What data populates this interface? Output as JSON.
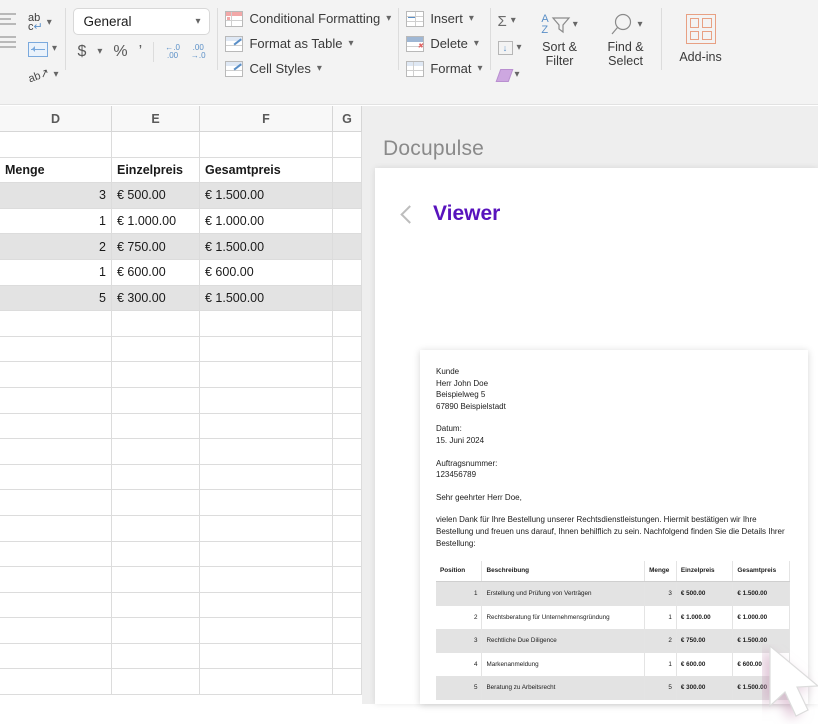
{
  "ribbon": {
    "alignment": {
      "wrap_text_label": "ab",
      "wrap_text_sub": "c",
      "merge_label": "merge-cells",
      "orientation_label": "ab"
    },
    "number": {
      "format_value": "General",
      "currency_label": "$",
      "percent_label": "%",
      "comma_label": "’",
      "increase_decimal_label": ".00",
      "decrease_decimal_label": ".0"
    },
    "styles": [
      {
        "label": "Conditional Formatting",
        "icon": "conditional-formatting-icon"
      },
      {
        "label": "Format as Table",
        "icon": "format-as-table-icon"
      },
      {
        "label": "Cell Styles",
        "icon": "cell-styles-icon"
      }
    ],
    "cells": [
      {
        "label": "Insert",
        "icon": "insert-cells-icon"
      },
      {
        "label": "Delete",
        "icon": "delete-cells-icon"
      },
      {
        "label": "Format",
        "icon": "format-cells-icon"
      }
    ],
    "editing": {
      "autosum_label": "Σ",
      "fill_label": "fill-icon",
      "clear_label": "clear-icon",
      "sort_filter_line1": "Sort &",
      "sort_filter_line2": "Filter",
      "find_select_line1": "Find &",
      "find_select_line2": "Select"
    },
    "addins": {
      "label": "Add-ins"
    }
  },
  "sheet": {
    "columns": [
      "D",
      "E",
      "F",
      "G"
    ],
    "rows": [
      {
        "shaded": false,
        "cells": [
          "",
          "",
          "",
          ""
        ]
      },
      {
        "shaded": false,
        "header": true,
        "cells": [
          "Menge",
          "Einzelpreis",
          "Gesamtpreis",
          ""
        ]
      },
      {
        "shaded": true,
        "cells": [
          "3",
          "€ 500.00",
          "€ 1.500.00",
          ""
        ]
      },
      {
        "shaded": false,
        "cells": [
          "1",
          "€ 1.000.00",
          "€ 1.000.00",
          ""
        ]
      },
      {
        "shaded": true,
        "cells": [
          "2",
          "€ 750.00",
          "€ 1.500.00",
          ""
        ]
      },
      {
        "shaded": false,
        "cells": [
          "1",
          "€ 600.00",
          "€ 600.00",
          ""
        ]
      },
      {
        "shaded": true,
        "cells": [
          "5",
          "€ 300.00",
          "€ 1.500.00",
          ""
        ]
      },
      {
        "shaded": false,
        "cells": [
          "",
          "",
          "",
          ""
        ]
      },
      {
        "shaded": false,
        "cells": [
          "",
          "",
          "",
          ""
        ]
      },
      {
        "shaded": false,
        "cells": [
          "",
          "",
          "",
          ""
        ]
      },
      {
        "shaded": false,
        "cells": [
          "",
          "",
          "",
          ""
        ]
      },
      {
        "shaded": false,
        "cells": [
          "",
          "",
          "",
          ""
        ]
      },
      {
        "shaded": false,
        "cells": [
          "",
          "",
          "",
          ""
        ]
      },
      {
        "shaded": false,
        "cells": [
          "",
          "",
          "",
          ""
        ]
      },
      {
        "shaded": false,
        "cells": [
          "",
          "",
          "",
          ""
        ]
      },
      {
        "shaded": false,
        "cells": [
          "",
          "",
          "",
          ""
        ]
      },
      {
        "shaded": false,
        "cells": [
          "",
          "",
          "",
          ""
        ]
      },
      {
        "shaded": false,
        "cells": [
          "",
          "",
          "",
          ""
        ]
      },
      {
        "shaded": false,
        "cells": [
          "",
          "",
          "",
          ""
        ]
      },
      {
        "shaded": false,
        "cells": [
          "",
          "",
          "",
          ""
        ]
      },
      {
        "shaded": false,
        "cells": [
          "",
          "",
          "",
          ""
        ]
      },
      {
        "shaded": false,
        "cells": [
          "",
          "",
          "",
          ""
        ]
      }
    ]
  },
  "panel": {
    "app_title": "Docupulse",
    "viewer_title": "Viewer",
    "back_icon": "chevron-left-icon",
    "accent_color": "#5813bd"
  },
  "document": {
    "customer_label": "Kunde",
    "customer_name": "Herr John Doe",
    "customer_street": "Beispielweg 5",
    "customer_city": "67890 Beispielstadt",
    "date_label": "Datum:",
    "date_value": "15. Juni 2024",
    "order_label": "Auftragsnummer:",
    "order_value": "123456789",
    "salutation": "Sehr geehrter Herr Doe,",
    "body": "vielen Dank für Ihre Bestellung unserer Rechtsdienstleistungen. Hiermit bestätigen wir Ihre Bestellung und freuen uns darauf, Ihnen behilflich zu sein. Nachfolgend finden Sie die Details Ihrer Bestellung:",
    "table": {
      "headers": [
        "Position",
        "Beschreibung",
        "Menge",
        "Einzelpreis",
        "Gesamtpreis"
      ],
      "rows": [
        {
          "alt": true,
          "cells": [
            "1",
            "Erstellung und Prüfung von Verträgen",
            "3",
            "€ 500.00",
            "€ 1.500.00"
          ]
        },
        {
          "alt": false,
          "cells": [
            "2",
            "Rechtsberatung für Unternehmensgründung",
            "1",
            "€ 1.000.00",
            "€ 1.000.00"
          ]
        },
        {
          "alt": true,
          "cells": [
            "3",
            "Rechtliche Due Diligence",
            "2",
            "€ 750.00",
            "€ 1.500.00"
          ]
        },
        {
          "alt": false,
          "cells": [
            "4",
            "Markenanmeldung",
            "1",
            "€ 600.00",
            "€ 600.00"
          ]
        },
        {
          "alt": true,
          "cells": [
            "5",
            "Beratung zu Arbeitsrecht",
            "5",
            "€ 300.00",
            "€ 1.500.00"
          ]
        }
      ]
    }
  },
  "cursor": {
    "icon": "mouse-pointer-icon"
  }
}
